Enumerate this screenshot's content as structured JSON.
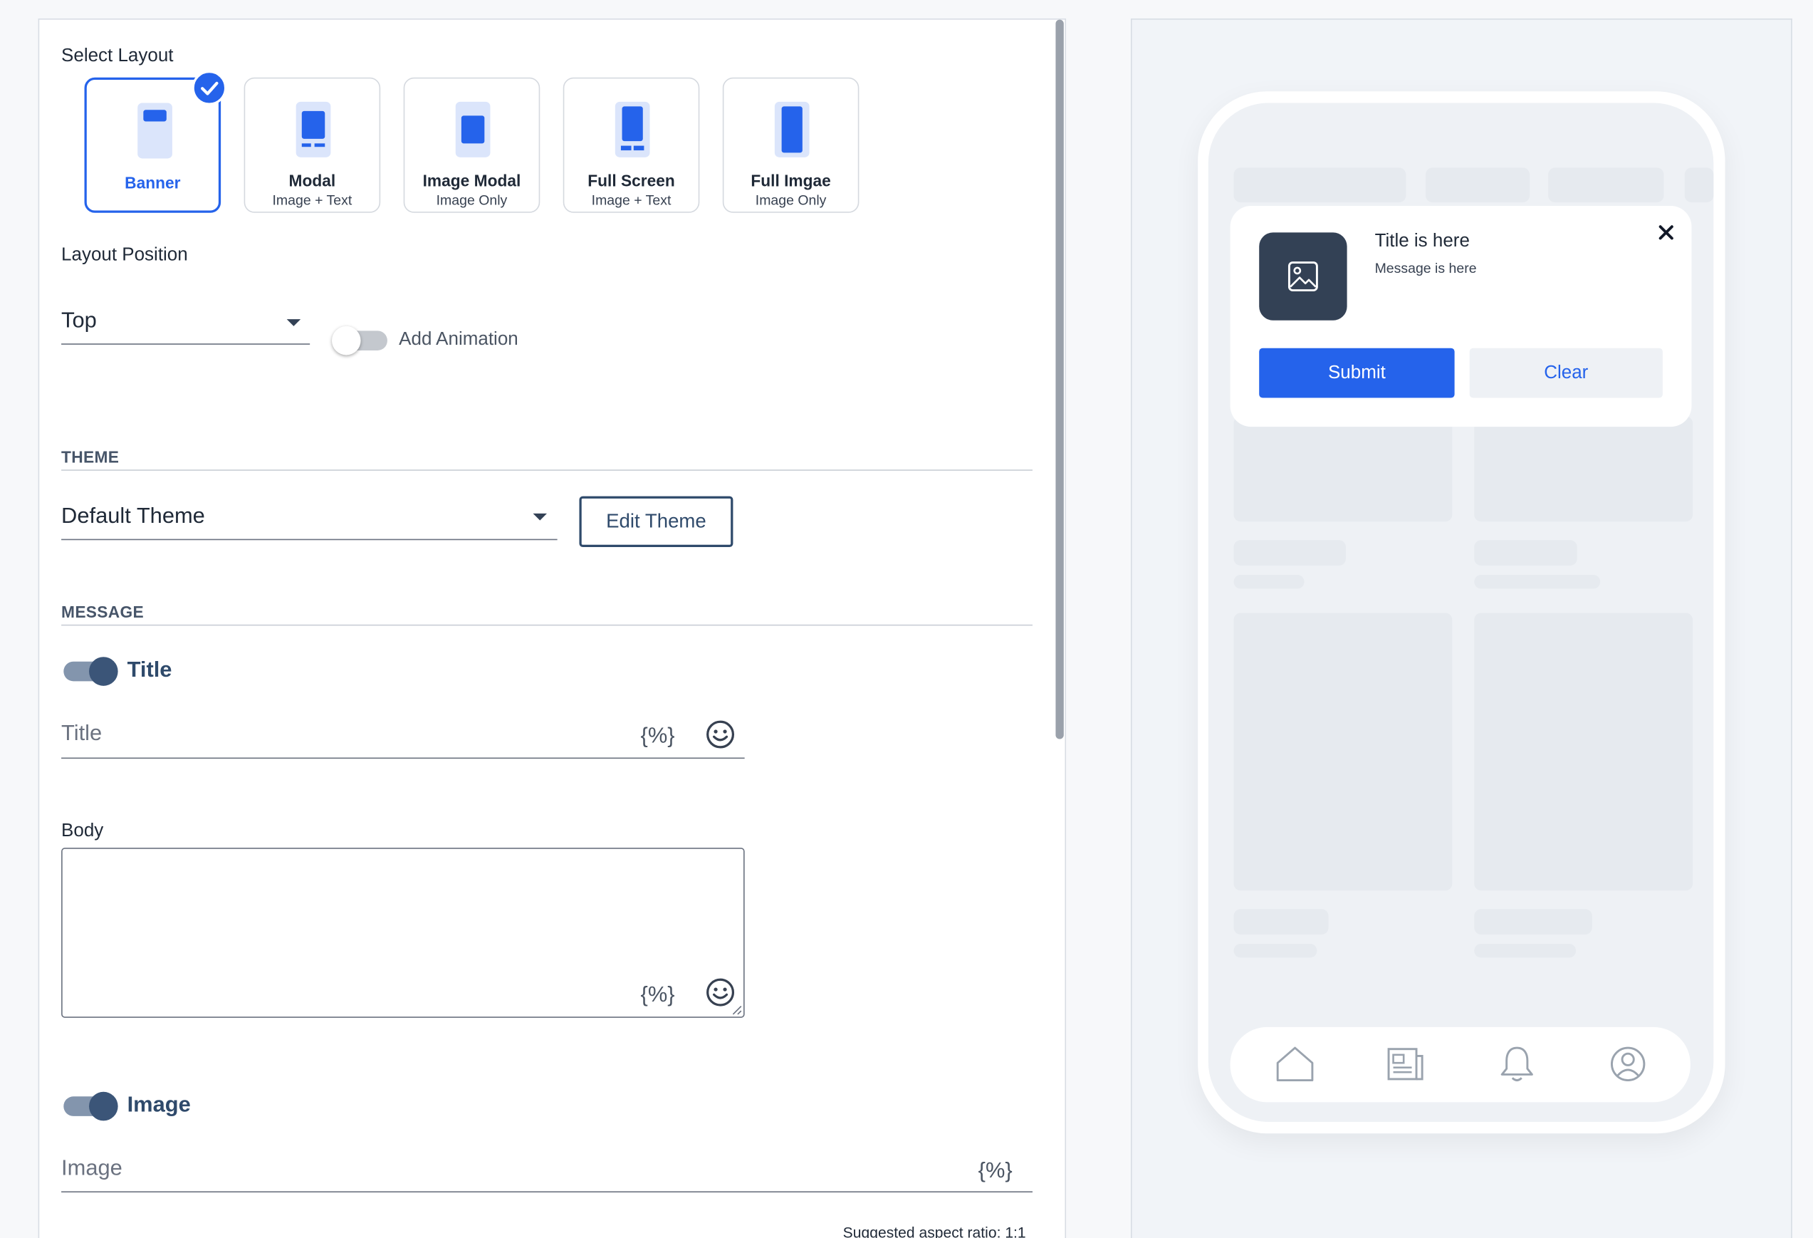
{
  "editor": {
    "select_layout_label": "Select Layout",
    "layouts": [
      {
        "title": "Banner",
        "subtitle": "",
        "selected": true
      },
      {
        "title": "Modal",
        "subtitle": "Image + Text",
        "selected": false
      },
      {
        "title": "Image Modal",
        "subtitle": "Image Only",
        "selected": false
      },
      {
        "title": "Full Screen",
        "subtitle": "Image + Text",
        "selected": false
      },
      {
        "title": "Full Imgae",
        "subtitle": "Image Only",
        "selected": false
      }
    ],
    "layout_position_label": "Layout Position",
    "layout_position_value": "Top",
    "add_animation_label": "Add Animation",
    "add_animation_on": false,
    "theme_section": "THEME",
    "theme_value": "Default Theme",
    "edit_theme_label": "Edit Theme",
    "message_section": "MESSAGE",
    "title_toggle_label": "Title",
    "title_toggle_on": true,
    "title_placeholder": "Title",
    "variable_token": "{%}",
    "body_label": "Body",
    "image_toggle_label": "Image",
    "image_toggle_on": true,
    "image_placeholder": "Image",
    "aspect_hint": "Suggested aspect ratio: 1:1"
  },
  "preview": {
    "banner_title": "Title is here",
    "banner_message": "Message is here",
    "submit_label": "Submit",
    "clear_label": "Clear",
    "tab_icons": [
      "home-icon",
      "news-icon",
      "bell-icon",
      "profile-icon"
    ]
  },
  "colors": {
    "accent": "#2563eb",
    "toggle_on_knob": "#3b5578",
    "toggle_on_track": "#8395ad",
    "navy_text": "#2f4a6b"
  }
}
